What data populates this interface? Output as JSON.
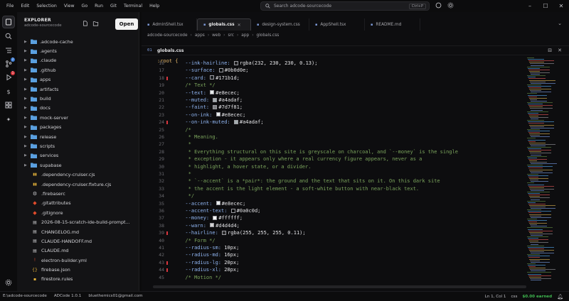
{
  "menu": [
    "File",
    "Edit",
    "Selection",
    "View",
    "Go",
    "Run",
    "Git",
    "Terminal",
    "Help"
  ],
  "search": {
    "placeholder": "Search adcode-sourcecode",
    "shortcut": "Ctrl+P"
  },
  "activity_badges": {
    "git": "2",
    "debug": "1"
  },
  "explorer": {
    "title": "EXPLORER",
    "subtitle": "adcode-sourcecode",
    "open_label": "Open",
    "folders": [
      ".adcode-cache",
      ".agents",
      ".claude",
      ".github",
      "apps",
      "artifacts",
      "build",
      "docs",
      "mock-server",
      "packages",
      "release",
      "scripts",
      "services",
      "supabase"
    ],
    "files": [
      {
        "name": ".dependency-cruiser.cjs",
        "icon": "js-icon",
        "color": "#c9c9cc"
      },
      {
        "name": ".dependency-cruiser.fixture.cjs",
        "icon": "js-icon",
        "color": "#c9c9cc"
      },
      {
        "name": ".firebaserc",
        "icon": "gear-icon",
        "color": "#c9c9cc"
      },
      {
        "name": ".gitattributes",
        "icon": "git-icon",
        "color": "#e24c2c"
      },
      {
        "name": ".gitignore",
        "icon": "git-icon",
        "color": "#e24c2c"
      },
      {
        "name": "2026-08-15-scratch-ide-build-prompt...",
        "icon": "markdown-icon",
        "color": "#c9c9cc"
      },
      {
        "name": "CHANGELOG.md",
        "icon": "markdown-icon",
        "color": "#c9c9cc"
      },
      {
        "name": "CLAUDE-HANDOFF.md",
        "icon": "markdown-icon",
        "color": "#c9c9cc"
      },
      {
        "name": "CLAUDE.md",
        "icon": "markdown-icon",
        "color": "#c9c9cc"
      },
      {
        "name": "electron-builder.yml",
        "icon": "yaml-icon",
        "color": "#e24c2c"
      },
      {
        "name": "firebase.json",
        "icon": "json-icon",
        "color": "#e7b43a"
      },
      {
        "name": "firestore.rules",
        "icon": "file-icon",
        "color": "#e7b43a"
      }
    ]
  },
  "tabs": [
    {
      "label": "AdminShell.tsx",
      "active": false
    },
    {
      "label": "globals.css",
      "active": true
    },
    {
      "label": "design-system.css",
      "active": false
    },
    {
      "label": "AppShell.tsx",
      "active": false
    },
    {
      "label": "README.md",
      "active": false
    }
  ],
  "breadcrumb": [
    "adcode-sourcecode",
    "apps",
    "web",
    "src",
    "app",
    "globals.css"
  ],
  "subhead": {
    "index": "01",
    "filename": "globals.css"
  },
  "code": {
    "top_selector": ":root {",
    "lines": [
      {
        "n": "16",
        "tokens": [
          {
            "t": "  --ink-hairline: ",
            "c": "prop"
          },
          {
            "t": "rgba(232, 230, 230, 0.13);",
            "c": "val",
            "sw": "#1e1e1e"
          }
        ]
      },
      {
        "n": "17",
        "tokens": [
          {
            "t": "  --surface: ",
            "c": "prop"
          },
          {
            "t": "#0b0d0e;",
            "c": "val",
            "sw": "#0b0d0e"
          }
        ]
      },
      {
        "n": "18",
        "mark": true,
        "tokens": [
          {
            "t": "  --card: ",
            "c": "prop"
          },
          {
            "t": "#171b1d;",
            "c": "val",
            "sw": "#171b1d"
          }
        ]
      },
      {
        "n": "19",
        "tokens": [
          {
            "t": "  /* Text */",
            "c": "cm"
          }
        ]
      },
      {
        "n": "20",
        "tokens": [
          {
            "t": "  --text: ",
            "c": "prop"
          },
          {
            "t": "#e8ecec;",
            "c": "val",
            "sw": "#e8ecec"
          }
        ]
      },
      {
        "n": "21",
        "tokens": [
          {
            "t": "  --muted: ",
            "c": "prop"
          },
          {
            "t": "#a4adaf;",
            "c": "val",
            "sw": "#a4adaf"
          }
        ]
      },
      {
        "n": "22",
        "tokens": [
          {
            "t": "  --faint: ",
            "c": "prop"
          },
          {
            "t": "#7d7f81;",
            "c": "val",
            "sw": "#7d7f81"
          }
        ]
      },
      {
        "n": "23",
        "tokens": [
          {
            "t": "  --on-ink: ",
            "c": "prop"
          },
          {
            "t": "#e8ecec;",
            "c": "val",
            "sw": "#e8ecec"
          }
        ]
      },
      {
        "n": "24",
        "mark": true,
        "tokens": [
          {
            "t": "  --on-ink-muted: ",
            "c": "prop"
          },
          {
            "t": "#a4adaf;",
            "c": "val",
            "sw": "#a4adaf"
          }
        ]
      },
      {
        "n": "25",
        "tokens": [
          {
            "t": "  /*",
            "c": "cm"
          }
        ]
      },
      {
        "n": "26",
        "tokens": [
          {
            "t": "   * Meaning.",
            "c": "cm"
          }
        ]
      },
      {
        "n": "27",
        "tokens": [
          {
            "t": "   *",
            "c": "cm"
          }
        ]
      },
      {
        "n": "28",
        "tokens": [
          {
            "t": "   * Everything structural on this site is greyscale on charcoal, and `--money` is the single",
            "c": "cm"
          }
        ]
      },
      {
        "n": "29",
        "tokens": [
          {
            "t": "   * exception - it appears only where a real currency figure appears, never as a",
            "c": "cm"
          }
        ]
      },
      {
        "n": "30",
        "tokens": [
          {
            "t": "   * highlight, a hover state, or a divider.",
            "c": "cm"
          }
        ]
      },
      {
        "n": "31",
        "tokens": [
          {
            "t": "   *",
            "c": "cm"
          }
        ]
      },
      {
        "n": "32",
        "tokens": [
          {
            "t": "   * `--accent` is a *pair*: the ground and the text that sits on it. On this dark site",
            "c": "cm"
          }
        ]
      },
      {
        "n": "33",
        "tokens": [
          {
            "t": "   * the accent is the light element - a soft-white button with near-black text.",
            "c": "cm"
          }
        ]
      },
      {
        "n": "34",
        "tokens": [
          {
            "t": "   */",
            "c": "cm"
          }
        ]
      },
      {
        "n": "35",
        "tokens": [
          {
            "t": "  --accent: ",
            "c": "prop"
          },
          {
            "t": "#e8ecec;",
            "c": "val",
            "sw": "#e8ecec"
          }
        ]
      },
      {
        "n": "36",
        "tokens": [
          {
            "t": "  --accent-text: ",
            "c": "prop"
          },
          {
            "t": "#0a0c0d;",
            "c": "val",
            "sw": "#0a0c0d"
          }
        ]
      },
      {
        "n": "37",
        "tokens": [
          {
            "t": "  --money: ",
            "c": "prop"
          },
          {
            "t": "#ffffff;",
            "c": "val",
            "sw": "#ffffff"
          }
        ]
      },
      {
        "n": "38",
        "tokens": [
          {
            "t": "  --warn: ",
            "c": "prop"
          },
          {
            "t": "#d4d4d4;",
            "c": "val",
            "sw": "#d4d4d4"
          }
        ]
      },
      {
        "n": "39",
        "mark": true,
        "tokens": [
          {
            "t": "  --hairline: ",
            "c": "prop"
          },
          {
            "t": "rgba(255, 255, 255, 0.11);",
            "c": "val",
            "sw": "#2a2a2a"
          }
        ]
      },
      {
        "n": "40",
        "tokens": [
          {
            "t": "  /* Form */",
            "c": "cm"
          }
        ]
      },
      {
        "n": "41",
        "tokens": [
          {
            "t": "  --radius-sm: ",
            "c": "prop"
          },
          {
            "t": "10px;",
            "c": "val"
          }
        ]
      },
      {
        "n": "42",
        "tokens": [
          {
            "t": "  --radius-md: ",
            "c": "prop"
          },
          {
            "t": "16px;",
            "c": "val"
          }
        ]
      },
      {
        "n": "43",
        "mark": true,
        "tokens": [
          {
            "t": "  --radius-lg: ",
            "c": "prop"
          },
          {
            "t": "20px;",
            "c": "val"
          }
        ]
      },
      {
        "n": "44",
        "mark": true,
        "tokens": [
          {
            "t": "  --radius-xl: ",
            "c": "prop"
          },
          {
            "t": "28px;",
            "c": "val"
          }
        ]
      },
      {
        "n": "45",
        "tokens": [
          {
            "t": "  /* Motion */",
            "c": "cm"
          }
        ]
      }
    ]
  },
  "status": {
    "left": [
      "E:\\adcode-sourcecode",
      "ADCode 1.0.1",
      "bluethemics01@gmail.com"
    ],
    "position": "Ln 1, Col 1",
    "language": "css",
    "money": "$0.00 earned"
  },
  "colors": {
    "accent": "#e8ecec",
    "money": "#3fb950",
    "folder": "#5aa0e0",
    "mark": "#d9363e"
  }
}
